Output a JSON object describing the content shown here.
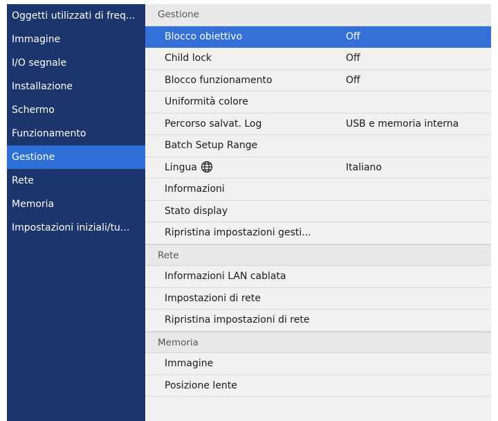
{
  "sidebar": {
    "items": [
      {
        "label": "Oggetti utilizzati di freq..."
      },
      {
        "label": "Immagine"
      },
      {
        "label": "I/O segnale"
      },
      {
        "label": "Installazione"
      },
      {
        "label": "Schermo"
      },
      {
        "label": "Funzionamento"
      },
      {
        "label": "Gestione"
      },
      {
        "label": "Rete"
      },
      {
        "label": "Memoria"
      },
      {
        "label": "Impostazioni iniziali/tu..."
      }
    ]
  },
  "gestione": {
    "header": "Gestione",
    "items": [
      {
        "label": "Blocco obiettivo",
        "value": "Off"
      },
      {
        "label": "Child lock",
        "value": "Off"
      },
      {
        "label": "Blocco funzionamento",
        "value": "Off"
      },
      {
        "label": "Uniformità colore"
      },
      {
        "label": "Percorso salvat. Log",
        "value": "USB e memoria interna"
      },
      {
        "label": "Batch Setup Range"
      },
      {
        "label": "Lingua",
        "value": "Italiano",
        "icon": "globe-icon"
      },
      {
        "label": "Informazioni"
      },
      {
        "label": "Stato display"
      },
      {
        "label": "Ripristina impostazioni gesti..."
      }
    ]
  },
  "rete": {
    "header": "Rete",
    "items": [
      {
        "label": "Informazioni LAN cablata"
      },
      {
        "label": "Impostazioni di rete"
      },
      {
        "label": "Ripristina impostazioni di rete"
      }
    ]
  },
  "memoria": {
    "header": "Memoria",
    "items": [
      {
        "label": "Immagine"
      },
      {
        "label": "Posizione lente"
      }
    ]
  },
  "colors": {
    "sidebar_bg": "#1c356c",
    "sidebar_active": "#2e6fd5",
    "row_selected": "#3470d6",
    "panel_bg": "#f1f1f1"
  }
}
